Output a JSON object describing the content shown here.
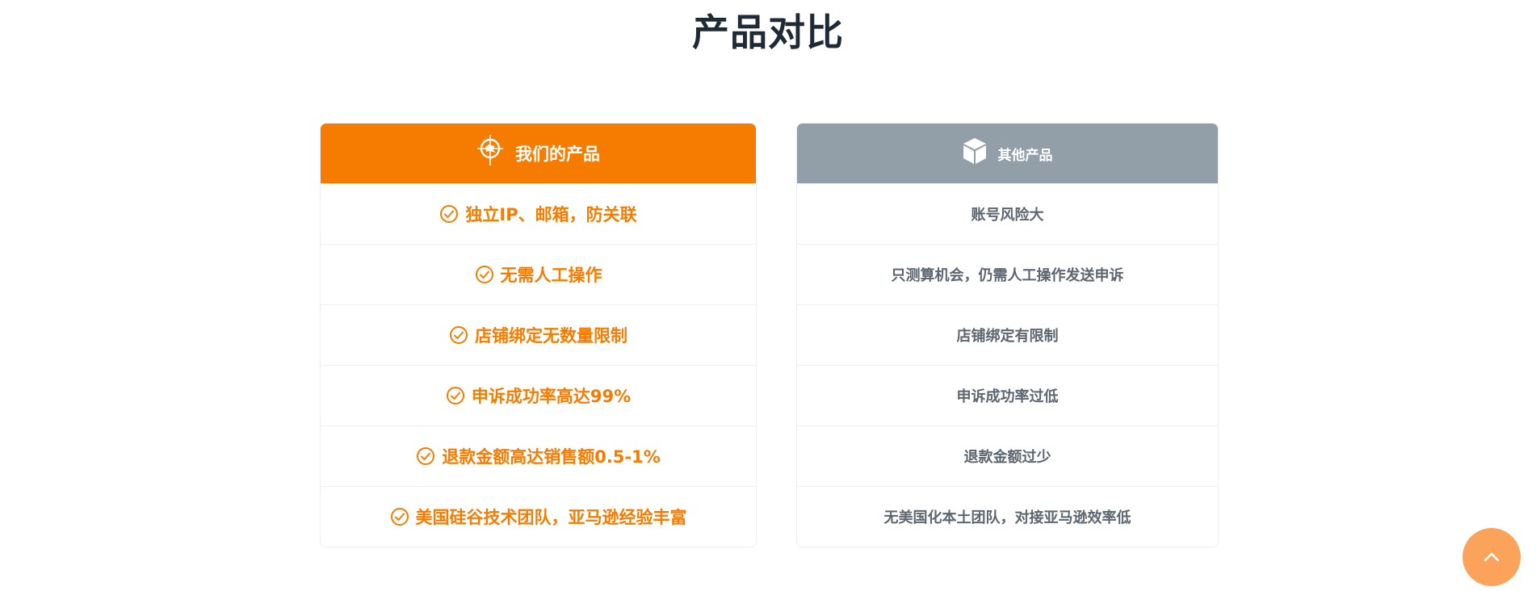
{
  "page": {
    "title": "产品对比"
  },
  "colors": {
    "accent": "#f57c00",
    "muted_header": "#939fa8",
    "muted_text": "#5c6670",
    "back_to_top": "#fba35a"
  },
  "ours": {
    "icon": "target-icon",
    "header": "我们的产品",
    "row_icon": "check-circle-icon",
    "rows": [
      "独立IP、邮箱，防关联",
      "无需人工操作",
      "店铺绑定无数量限制",
      "申诉成功率高达99%",
      "退款金额高达销售额0.5-1%",
      "美国硅谷技术团队，亚马逊经验丰富"
    ]
  },
  "other": {
    "icon": "cube-icon",
    "header": "其他产品",
    "rows": [
      "账号风险大",
      "只测算机会，仍需人工操作发送申诉",
      "店铺绑定有限制",
      "申诉成功率过低",
      "退款金额过少",
      "无美国化本土团队，对接亚马逊效率低"
    ]
  },
  "back_to_top": {
    "icon": "chevron-up-icon"
  }
}
